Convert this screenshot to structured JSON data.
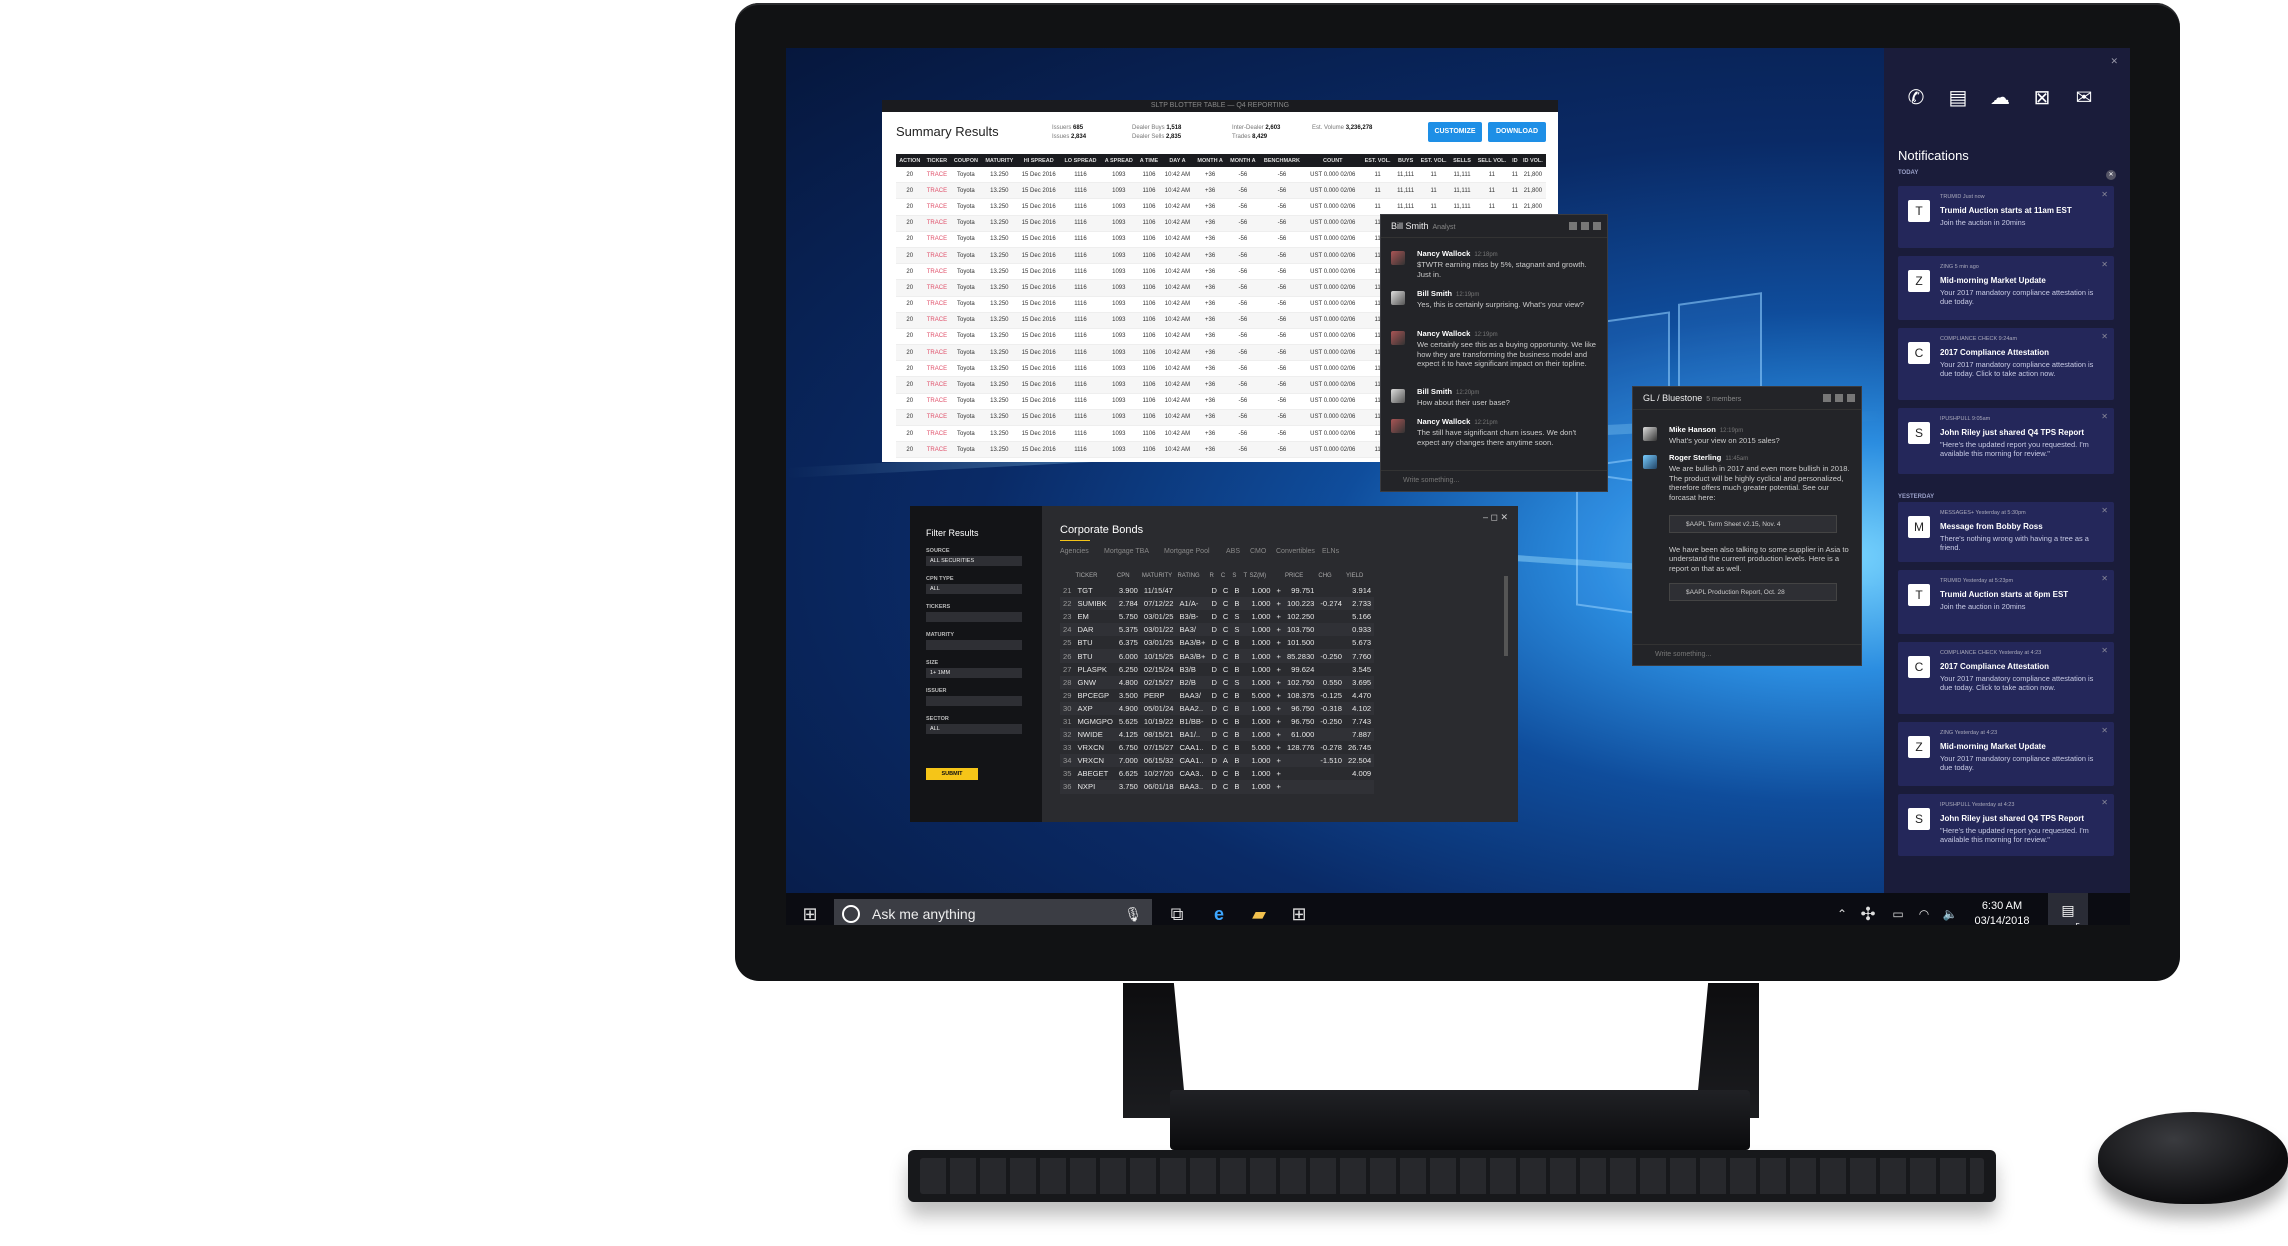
{
  "summary_window": {
    "titlebar": "SLTP BLOTTER TABLE — Q4 REPORTING",
    "title": "Summary Results",
    "stats": [
      {
        "label": "Issuers",
        "value": "685"
      },
      {
        "label": "Issues",
        "value": "2,834"
      },
      {
        "label": "Dealer Buys",
        "value": "1,518"
      },
      {
        "label": "Dealer Sells",
        "value": "2,835"
      },
      {
        "label": "Inter-Dealer",
        "value": "2,603"
      },
      {
        "label": "Trades",
        "value": "8,429"
      },
      {
        "label": "Est. Volume",
        "value": "3,236,278"
      }
    ],
    "customize_label": "CUSTOMIZE",
    "download_label": "DOWNLOAD",
    "columns": [
      "ACTION",
      "TICKER",
      "COUPON",
      "MATURITY",
      "HI SPREAD",
      "LO SPREAD",
      "A SPREAD",
      "A TIME",
      "DAY A",
      "MONTH A",
      "MONTH A",
      "BENCHMARK",
      "COUNT",
      "EST. VOL.",
      "BUYS",
      "EST. VOL.",
      "SELLS",
      "SELL VOL.",
      "ID",
      "ID VOL."
    ],
    "row": [
      "20",
      "TRACE",
      "Toyota",
      "13.250",
      "15 Dec 2016",
      "1116",
      "1093",
      "1106",
      "10:42 AM",
      "+36",
      "-56",
      "-56",
      "UST 0.000 02/06",
      "11",
      "11,111",
      "11",
      "11,111",
      "11",
      "11",
      "21,800"
    ],
    "row_count": 20
  },
  "chat_bill": {
    "name": "Bill Smith",
    "role": "Analyst",
    "messages": [
      {
        "name": "Nancy Wallock",
        "time": "12:18pm",
        "text": "$TWTR earning miss by 5%, stagnant and growth. Just in."
      },
      {
        "name": "Bill Smith",
        "time": "12:19pm",
        "text": "Yes, this is certainly surprising. What's your view?"
      },
      {
        "name": "Nancy Wallock",
        "time": "12:19pm",
        "text": "We certainly see this as a buying opportunity. We like how they are transforming the business model and expect it to have significant impact on their topline."
      },
      {
        "name": "Bill Smith",
        "time": "12:20pm",
        "text": "How about their user base?"
      },
      {
        "name": "Nancy Wallock",
        "time": "12:21pm",
        "text": "The still have significant churn issues. We don't expect any changes there anytime soon."
      }
    ],
    "placeholder": "Write something..."
  },
  "chat_group": {
    "name": "GL / Bluestone",
    "members": "5 members",
    "messages": [
      {
        "name": "Mike Hanson",
        "time": "12:19pm",
        "text": "What's your view on 2015 sales?"
      },
      {
        "name": "Roger Sterling",
        "time": "11:45am",
        "text": "We are bullish in 2017 and even more bullish in 2018. The product will be highly cyclical and personalized, therefore offers much greater potential. See our forcasat here:"
      }
    ],
    "attachment1": "$AAPL Term Sheet v2.15, Nov. 4",
    "text2": "We have been also talking to some supplier in Asia to understand the current production levels. Here is a report on that as well.",
    "attachment2": "$AAPL Production Report, Oct. 28",
    "placeholder": "Write something..."
  },
  "bonds_window": {
    "filter_title": "Filter Results",
    "filters": [
      {
        "label": "SOURCE",
        "value": "ALL SECURITIES"
      },
      {
        "label": "CPN TYPE",
        "value": "ALL"
      },
      {
        "label": "TICKERS",
        "value": ""
      },
      {
        "label": "MATURITY",
        "value": ""
      },
      {
        "label": "SIZE",
        "value": "1+ 1MM"
      },
      {
        "label": "ISSUER",
        "value": ""
      },
      {
        "label": "SECTOR",
        "value": "ALL"
      }
    ],
    "submit_label": "SUBMIT",
    "title": "Corporate  Bonds",
    "tabs": [
      "Agencies",
      "Mortgage TBA",
      "Mortgage Pool",
      "ABS",
      "CMO",
      "Convertibles",
      "ELNs"
    ],
    "columns": [
      "",
      "TICKER",
      "CPN",
      "MATURITY",
      "RATING",
      "R",
      "C",
      "S",
      "T",
      "SZ(M)",
      "",
      "PRICE",
      "CHG",
      "YIELD"
    ],
    "rows": [
      [
        "21",
        "TGT",
        "3.900",
        "11/15/47",
        "",
        "D",
        "C",
        "B",
        "",
        "1.000",
        "+",
        "99.751",
        "",
        "3.914"
      ],
      [
        "22",
        "SUMIBK",
        "2.784",
        "07/12/22",
        "A1/A-",
        "D",
        "C",
        "B",
        "",
        "1.000",
        "+",
        "100.223",
        "-0.274",
        "2.733"
      ],
      [
        "23",
        "EM",
        "5.750",
        "03/01/25",
        "B3/B-",
        "D",
        "C",
        "S",
        "",
        "1.000",
        "+",
        "102.250",
        "",
        "5.166"
      ],
      [
        "24",
        "DAR",
        "5.375",
        "03/01/22",
        "BA3/",
        "D",
        "C",
        "S",
        "",
        "1.000",
        "+",
        "103.750",
        "",
        "0.933"
      ],
      [
        "25",
        "BTU",
        "6.375",
        "03/01/25",
        "BA3/B+",
        "D",
        "C",
        "B",
        "",
        "1.000",
        "+",
        "101.500",
        "",
        "5.673"
      ],
      [
        "26",
        "BTU",
        "6.000",
        "10/15/25",
        "BA3/B+",
        "D",
        "C",
        "B",
        "",
        "1.000",
        "+",
        "85.2830",
        "-0.250",
        "7.760"
      ],
      [
        "27",
        "PLASPK",
        "6.250",
        "02/15/24",
        "B3/B",
        "D",
        "C",
        "B",
        "",
        "1.000",
        "+",
        "99.624",
        "",
        "3.545"
      ],
      [
        "28",
        "GNW",
        "4.800",
        "02/15/27",
        "B2/B",
        "D",
        "C",
        "S",
        "",
        "1.000",
        "+",
        "102.750",
        "0.550",
        "3.695"
      ],
      [
        "29",
        "BPCEGP",
        "3.500",
        "PERP",
        "BAA3/",
        "D",
        "C",
        "B",
        "",
        "5.000",
        "+",
        "108.375",
        "-0.125",
        "4.470"
      ],
      [
        "30",
        "AXP",
        "4.900",
        "05/01/24",
        "BAA2..",
        "D",
        "C",
        "B",
        "",
        "1.000",
        "+",
        "96.750",
        "-0.318",
        "4.102"
      ],
      [
        "31",
        "MGMGPO",
        "5.625",
        "10/19/22",
        "B1/BB-",
        "D",
        "C",
        "B",
        "",
        "1.000",
        "+",
        "96.750",
        "-0.250",
        "7.743"
      ],
      [
        "32",
        "NWIDE",
        "4.125",
        "08/15/21",
        "BA1/..",
        "D",
        "C",
        "B",
        "",
        "1.000",
        "+",
        "61.000",
        "",
        "7.887"
      ],
      [
        "33",
        "VRXCN",
        "6.750",
        "07/15/27",
        "CAA1..",
        "D",
        "C",
        "B",
        "",
        "5.000",
        "+",
        "128.776",
        "-0.278",
        "26.745"
      ],
      [
        "34",
        "VRXCN",
        "7.000",
        "06/15/32",
        "CAA1..",
        "D",
        "A",
        "B",
        "",
        "1.000",
        "+",
        "",
        "-1.510",
        "22.504"
      ],
      [
        "35",
        "ABEGET",
        "6.625",
        "10/27/20",
        "CAA3..",
        "D",
        "C",
        "B",
        "",
        "1.000",
        "+",
        "",
        "",
        "4.009"
      ],
      [
        "36",
        "NXPI",
        "3.750",
        "06/01/18",
        "BAA3..",
        "D",
        "C",
        "B",
        "",
        "1.000",
        "+",
        "",
        "",
        ""
      ]
    ]
  },
  "notifications": {
    "title": "Notifications",
    "sections": [
      "TODAY",
      "YESTERDAY"
    ],
    "app_icons": [
      "phone-icon",
      "blotter-icon",
      "symphony-icon",
      "excel-icon",
      "outlook-icon"
    ],
    "today": [
      {
        "source": "TRUMID  Just now",
        "title": "Trumid Auction starts at 11am EST",
        "body": "Join the auction in 20mins",
        "icon": "T"
      },
      {
        "source": "ZING  5 min ago",
        "title": "Mid-morning Market Update",
        "body": "Your 2017 mandatory compliance attestation is due today.",
        "icon": "Z"
      },
      {
        "source": "COMPLIANCE CHECK  9:24am",
        "title": "2017 Compliance Attestation",
        "body": "Your 2017 mandatory compliance attestation is due today. Click to take action now.",
        "icon": "C"
      },
      {
        "source": "IPUSHPULL  9:05am",
        "title": "John Riley just shared Q4 TPS Report",
        "body": "\"Here's the updated report you requested. I'm available this morning for review.\"",
        "icon": "S"
      }
    ],
    "yesterday": [
      {
        "source": "MESSAGES+  Yesterday at 5:30pm",
        "title": "Message from Bobby Ross",
        "body": "There's nothing wrong with having a tree as a friend.",
        "icon": "M"
      },
      {
        "source": "TRUMID  Yesterday at 5:23pm",
        "title": "Trumid Auction starts at 6pm EST",
        "body": "Join the auction in 20mins",
        "icon": "T"
      },
      {
        "source": "COMPLIANCE CHECK  Yesterday at 4:23",
        "title": "2017 Compliance Attestation",
        "body": "Your 2017 mandatory compliance attestation is due today. Click to take action now.",
        "icon": "C"
      },
      {
        "source": "ZING  Yesterday at 4:23",
        "title": "Mid-morning Market Update",
        "body": "Your 2017 mandatory compliance attestation is due today.",
        "icon": "Z"
      },
      {
        "source": "IPUSHPULL  Yesterday at 4:23",
        "title": "John Riley just shared Q4 TPS Report",
        "body": "\"Here's the updated report you requested. I'm available this morning for review.\"",
        "icon": "S"
      }
    ]
  },
  "taskbar": {
    "search_placeholder": "Ask me anything",
    "time": "6:30 AM",
    "date": "03/14/2018",
    "notification_count": "5"
  }
}
